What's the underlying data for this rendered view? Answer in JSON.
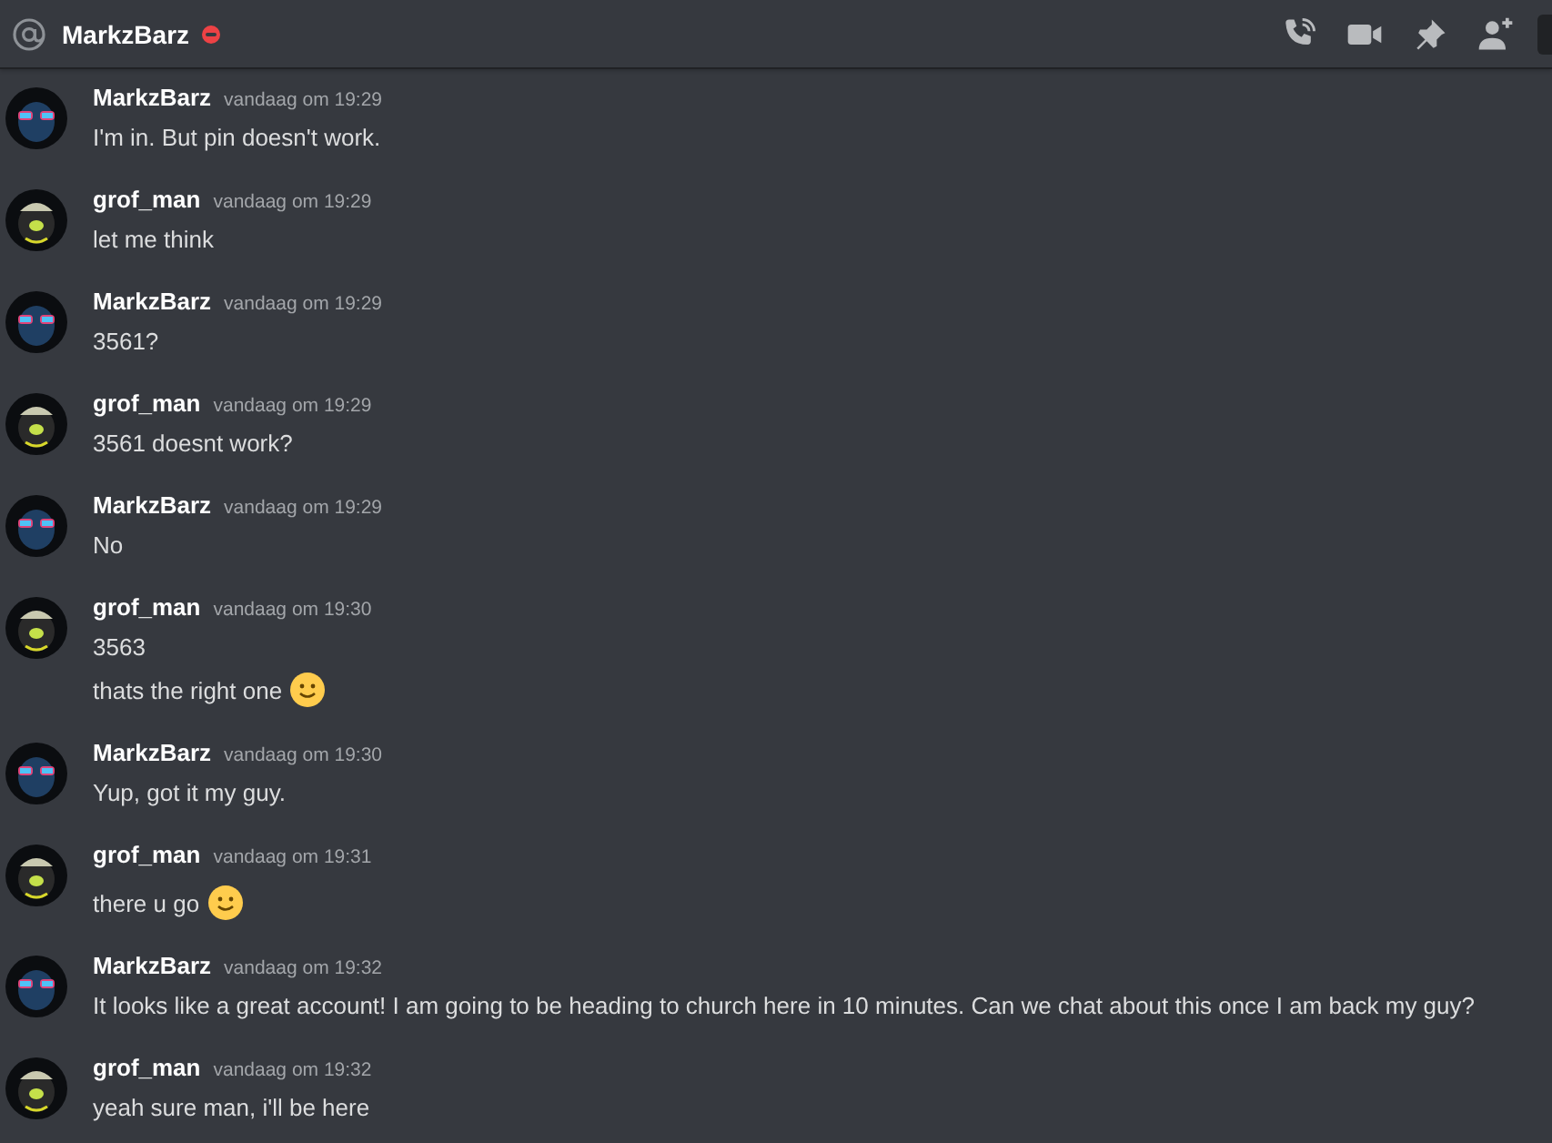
{
  "header": {
    "title": "MarkzBarz",
    "do_not_disturb": true
  },
  "messages": [
    {
      "author": "MarkzBarz",
      "kind": "glasses",
      "time": "vandaag om 19:29",
      "lines": [
        {
          "text": "I'm in. But pin doesn't work.",
          "emoji": false
        }
      ]
    },
    {
      "author": "grof_man",
      "kind": "cap",
      "time": "vandaag om 19:29",
      "lines": [
        {
          "text": "let me think",
          "emoji": false
        }
      ]
    },
    {
      "author": "MarkzBarz",
      "kind": "glasses",
      "time": "vandaag om 19:29",
      "lines": [
        {
          "text": "3561?",
          "emoji": false
        }
      ]
    },
    {
      "author": "grof_man",
      "kind": "cap",
      "time": "vandaag om 19:29",
      "lines": [
        {
          "text": "3561 doesnt work?",
          "emoji": false
        }
      ]
    },
    {
      "author": "MarkzBarz",
      "kind": "glasses",
      "time": "vandaag om 19:29",
      "lines": [
        {
          "text": "No",
          "emoji": false
        }
      ]
    },
    {
      "author": "grof_man",
      "kind": "cap",
      "time": "vandaag om 19:30",
      "lines": [
        {
          "text": "3563",
          "emoji": false
        },
        {
          "text": "thats the right one",
          "emoji": true
        }
      ]
    },
    {
      "author": "MarkzBarz",
      "kind": "glasses",
      "time": "vandaag om 19:30",
      "lines": [
        {
          "text": "Yup, got it my guy.",
          "emoji": false
        }
      ]
    },
    {
      "author": "grof_man",
      "kind": "cap",
      "time": "vandaag om 19:31",
      "lines": [
        {
          "text": "there u go",
          "emoji": true
        }
      ]
    },
    {
      "author": "MarkzBarz",
      "kind": "glasses",
      "time": "vandaag om 19:32",
      "lines": [
        {
          "text": "It looks like a great account! I am going to be heading to church here in 10 minutes. Can we chat about this once I am back my guy?",
          "emoji": false
        }
      ]
    },
    {
      "author": "grof_man",
      "kind": "cap",
      "time": "vandaag om 19:32",
      "lines": [
        {
          "text": "yeah sure man, i'll be here",
          "emoji": false
        }
      ]
    }
  ]
}
